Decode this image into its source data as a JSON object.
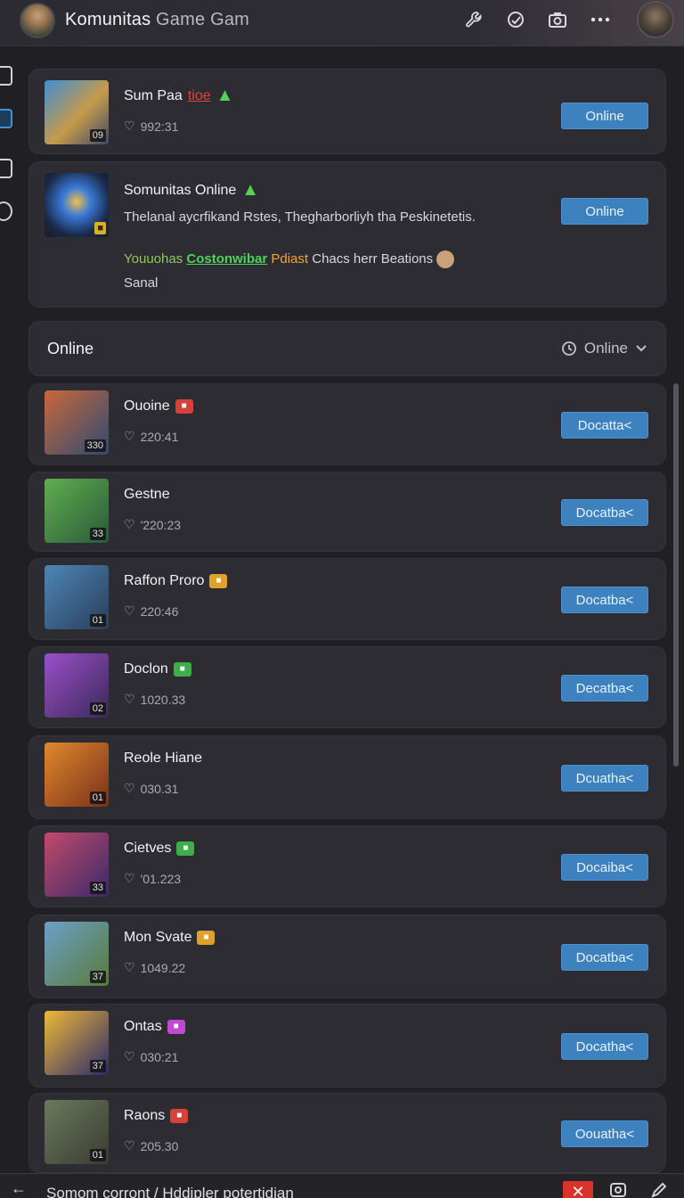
{
  "header": {
    "title_main": "Komunitas",
    "title_rest": " Game Gam"
  },
  "featured": [
    {
      "name": "Sum Paa",
      "tag": "tioe",
      "meta": "992:31",
      "thumb_num": "09",
      "button": "Online"
    },
    {
      "name": "Somunitas Online",
      "description": "Thelanal aycrfikand Rstes, Thegharborliyh tha Peskinetetis.",
      "tags": [
        "Youuohas",
        "Costonwibar",
        "Pdiast",
        "Chacs herr Beations"
      ],
      "sub": "Sanal",
      "button": "Online"
    }
  ],
  "section": {
    "label": "Online",
    "filter": "Online"
  },
  "items": [
    {
      "name": "Ouoine",
      "meta": "220:41",
      "num": "330",
      "button": "Docatta<",
      "badge_color": "#d8403a",
      "thumb": [
        "#c9683a",
        "#2f4a72"
      ]
    },
    {
      "name": "Gestne",
      "meta": "'220:23",
      "num": "33",
      "button": "Docatba<",
      "badge_color": "",
      "thumb": [
        "#5fae4e",
        "#2a5a3a"
      ]
    },
    {
      "name": "Raffon Proro",
      "meta": "220:46",
      "num": "01",
      "button": "Docatba<",
      "badge_color": "#e0a02e",
      "thumb": [
        "#4c86b8",
        "#2a3e58"
      ]
    },
    {
      "name": "Doclon",
      "meta": "1020.33",
      "num": "02",
      "button": "Decatba<",
      "badge_color": "#3fae4a",
      "thumb": [
        "#9a4fc8",
        "#3a2a58"
      ]
    },
    {
      "name": "Reole Hiane",
      "meta": "030.31",
      "num": "01",
      "button": "Dcuatha<",
      "badge_color": "",
      "thumb": [
        "#e0882e",
        "#7a3018"
      ]
    },
    {
      "name": "Cietves",
      "meta": "'01.223",
      "num": "33",
      "button": "Docaiba<",
      "badge_color": "#3fae4a",
      "thumb": [
        "#c24a6a",
        "#3a2a6a"
      ]
    },
    {
      "name": "Mon Svate",
      "meta": "1049.22",
      "num": "37",
      "button": "Docatba<",
      "badge_color": "#e0a02e",
      "thumb": [
        "#6aa0c8",
        "#5a7a3a"
      ]
    },
    {
      "name": "Ontas",
      "meta": "030:21",
      "num": "37",
      "button": "Docatha<",
      "badge_color": "#c04ad0",
      "thumb": [
        "#f0b838",
        "#2a2a68"
      ]
    },
    {
      "name": "Raons",
      "meta": "205.30",
      "num": "01",
      "button": "Oouatha<",
      "badge_color": "#d8403a",
      "thumb": [
        "#6a7a5a",
        "#3a3a32"
      ]
    }
  ],
  "bottom": {
    "breadcrumb": "Somom corront / Hddipler potertidian"
  }
}
